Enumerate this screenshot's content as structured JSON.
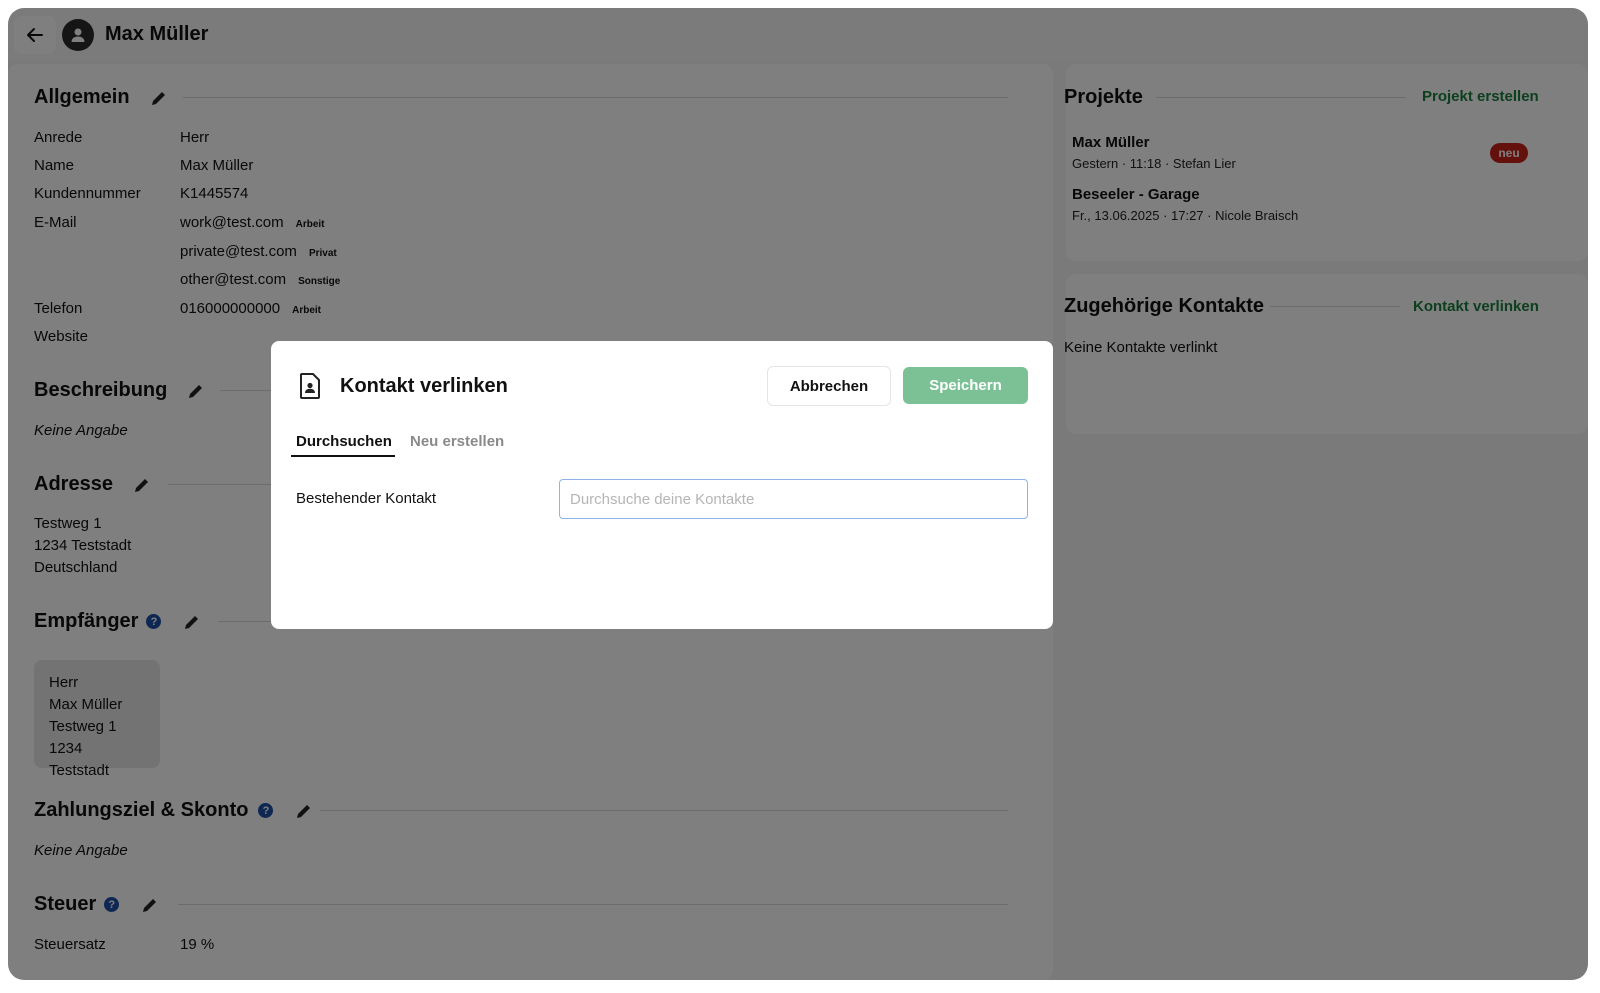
{
  "header": {
    "title": "Max Müller"
  },
  "allgemein": {
    "title": "Allgemein",
    "fields": [
      {
        "label": "Anrede",
        "value": "Herr"
      },
      {
        "label": "Name",
        "value": "Max Müller"
      },
      {
        "label": "Kundennummer",
        "value": "K1445574"
      }
    ],
    "email_label": "E-Mail",
    "emails": [
      {
        "value": "work@test.com",
        "tag": "Arbeit"
      },
      {
        "value": "private@test.com",
        "tag": "Privat"
      },
      {
        "value": "other@test.com",
        "tag": "Sonstige"
      }
    ],
    "phone_label": "Telefon",
    "phone": {
      "value": "016000000000",
      "tag": "Arbeit"
    },
    "website_label": "Website"
  },
  "beschreibung": {
    "title": "Beschreibung",
    "value": "Keine Angabe"
  },
  "adresse": {
    "title": "Adresse",
    "lines": [
      "Testweg 1",
      "1234 Teststadt",
      "Deutschland"
    ]
  },
  "empfaenger": {
    "title": "Empfänger",
    "help": "?",
    "lines": [
      "Herr",
      "Max Müller",
      "Testweg 1",
      "1234 Teststadt"
    ]
  },
  "zahlungsziel": {
    "title": "Zahlungsziel & Skonto",
    "help": "?",
    "value": "Keine Angabe"
  },
  "steuer": {
    "title": "Steuer",
    "help": "?",
    "label": "Steuersatz",
    "value": "19 %"
  },
  "projekte": {
    "title": "Projekte",
    "action": "Projekt erstellen",
    "items": [
      {
        "name": "Max Müller",
        "meta": "Gestern · 11:18 · Stefan Lier",
        "badge": "neu"
      },
      {
        "name": "Beseeler - Garage",
        "meta": "Fr., 13.06.2025 · 17:27 · Nicole Braisch"
      }
    ]
  },
  "kontakte": {
    "title": "Zugehörige Kontakte",
    "action": "Kontakt verlinken",
    "empty": "Keine Kontakte verlinkt"
  },
  "modal": {
    "title": "Kontakt verlinken",
    "cancel": "Abbrechen",
    "save": "Speichern",
    "tabs": [
      "Durchsuchen",
      "Neu erstellen"
    ],
    "field_label": "Bestehender Kontakt",
    "search_placeholder": "Durchsuche deine Kontakte",
    "search_value": ""
  },
  "colors": {
    "accent_green": "#1a7f3f",
    "save_button": "#7cc196",
    "badge_red": "#c9231d",
    "help_blue": "#1f4ea6"
  }
}
